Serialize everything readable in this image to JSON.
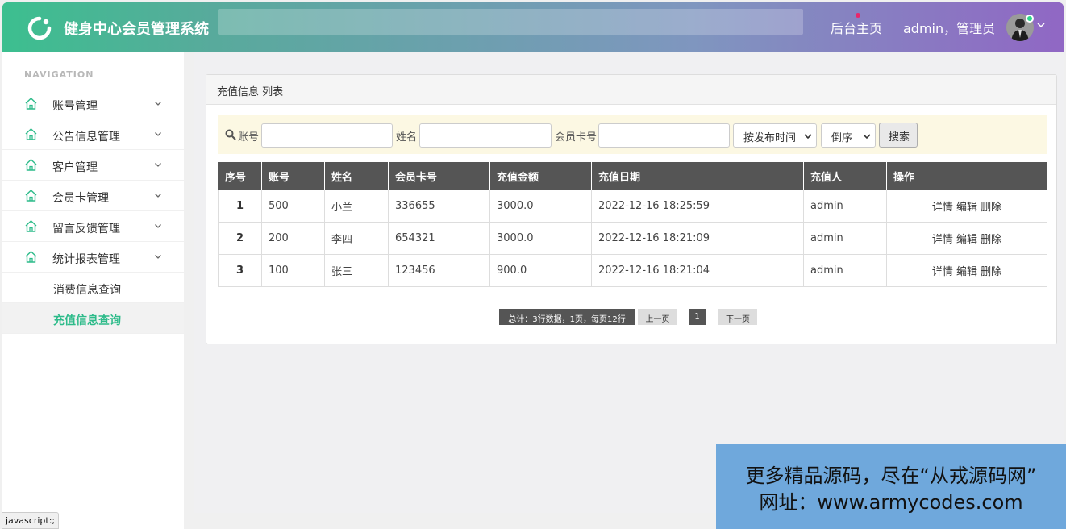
{
  "header": {
    "title": "健身中心会员管理系统",
    "home_link": "后台主页",
    "user": "admin，管理员",
    "logo_icon": "refresh-circle-icon",
    "colors": {
      "gradient_start": "#3cbf8f",
      "gradient_end": "#9067c4",
      "accent": "#2dbb8a"
    }
  },
  "sidebar": {
    "heading": "NAVIGATION",
    "items": [
      {
        "label": "账号管理",
        "icon": "home-icon"
      },
      {
        "label": "公告信息管理",
        "icon": "home-icon"
      },
      {
        "label": "客户管理",
        "icon": "home-icon"
      },
      {
        "label": "会员卡管理",
        "icon": "home-icon"
      },
      {
        "label": "留言反馈管理",
        "icon": "home-icon"
      },
      {
        "label": "统计报表管理",
        "icon": "home-icon"
      }
    ],
    "subitems": [
      {
        "label": "消费信息查询"
      },
      {
        "label": "充值信息查询",
        "active": true
      }
    ]
  },
  "panel": {
    "title": "充值信息 列表",
    "search": {
      "account_label": "账号",
      "name_label": "姓名",
      "card_label": "会员卡号",
      "sort_field": "按发布时间",
      "sort_order": "倒序",
      "button": "搜索"
    },
    "table": {
      "headers": [
        "序号",
        "账号",
        "姓名",
        "会员卡号",
        "充值金额",
        "充值日期",
        "充值人",
        "操作"
      ],
      "rows": [
        {
          "idx": "1",
          "account": "500",
          "name": "小兰",
          "card": "336655",
          "amount": "3000.0",
          "date": "2022-12-16 18:25:59",
          "by": "admin"
        },
        {
          "idx": "2",
          "account": "200",
          "name": "李四",
          "card": "654321",
          "amount": "3000.0",
          "date": "2022-12-16 18:21:09",
          "by": "admin"
        },
        {
          "idx": "3",
          "account": "100",
          "name": "张三",
          "card": "123456",
          "amount": "900.0",
          "date": "2022-12-16 18:21:04",
          "by": "admin"
        }
      ],
      "actions": {
        "detail": "详情",
        "edit": "编辑",
        "delete": "删除"
      }
    },
    "pagination": {
      "summary": "总计：3行数据，1页，每页12行",
      "prev": "上一页",
      "current": "1",
      "next": "下一页"
    }
  },
  "watermark": {
    "line1": "更多精品源码，尽在“从戎源码网”",
    "line2": "网址：www.armycodes.com"
  },
  "status_bar": "javascript:;"
}
